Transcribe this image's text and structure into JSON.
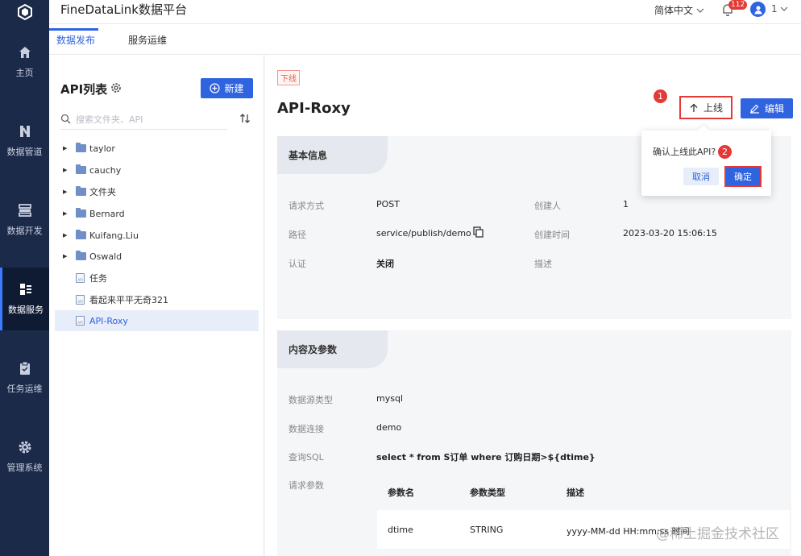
{
  "app": {
    "title": "FineDataLink数据平台"
  },
  "topbar": {
    "language": "简体中文",
    "notifications": "112",
    "user": "1"
  },
  "nav": [
    {
      "label": "主页",
      "icon": "home-icon"
    },
    {
      "label": "数据管道",
      "icon": "pipeline-icon"
    },
    {
      "label": "数据开发",
      "icon": "dev-icon"
    },
    {
      "label": "数据服务",
      "icon": "service-icon",
      "active": true
    },
    {
      "label": "任务运维",
      "icon": "clipboard-icon"
    },
    {
      "label": "管理系统",
      "icon": "gear-icon"
    }
  ],
  "tabs": [
    {
      "label": "数据发布",
      "active": true
    },
    {
      "label": "服务运维"
    }
  ],
  "api_list": {
    "title": "API列表",
    "new_label": "新建",
    "search_placeholder": "搜索文件夹、API",
    "items": [
      {
        "type": "folder",
        "label": "taylor"
      },
      {
        "type": "folder",
        "label": "cauchy"
      },
      {
        "type": "folder",
        "label": "文件夹"
      },
      {
        "type": "folder",
        "label": "Bernard"
      },
      {
        "type": "folder",
        "label": "Kuifang.Liu"
      },
      {
        "type": "folder",
        "label": "Oswald"
      },
      {
        "type": "api",
        "label": "任务"
      },
      {
        "type": "api",
        "label": "看起来平平无奇321"
      },
      {
        "type": "api",
        "label": "API-Roxy",
        "selected": true
      }
    ]
  },
  "detail": {
    "status_tag": "下线",
    "name": "API-Roxy",
    "online_label": "上线",
    "edit_label": "编辑",
    "basic": {
      "title": "基本信息",
      "method_label": "请求方式",
      "method": "POST",
      "path_label": "路径",
      "path": "service/publish/demo",
      "auth_label": "认证",
      "auth": "关闭",
      "creator_label": "创建人",
      "creator": "1",
      "created_label": "创建时间",
      "created": "2023-03-20 15:06:15",
      "desc_label": "描述"
    },
    "content": {
      "title": "内容及参数",
      "ds_type_label": "数据源类型",
      "ds_type": "mysql",
      "conn_label": "数据连接",
      "conn": "demo",
      "sql_label": "查询SQL",
      "sql": "select * from S订单 where 订购日期>${dtime}",
      "params_label": "请求参数",
      "params_headers": [
        "参数名",
        "参数类型",
        "描述"
      ],
      "params_rows": [
        [
          "dtime",
          "STRING",
          "yyyy-MM-dd HH:mm:ss 时间"
        ]
      ]
    }
  },
  "popconfirm": {
    "text": "确认上线此API?",
    "cancel": "取消",
    "ok": "确定"
  },
  "markers": [
    "1",
    "2"
  ],
  "watermark": "@稀土掘金技术社区",
  "colors": {
    "primary": "#2f63e0",
    "nav_bg": "#1c2a4a",
    "highlight": "#e53935"
  }
}
